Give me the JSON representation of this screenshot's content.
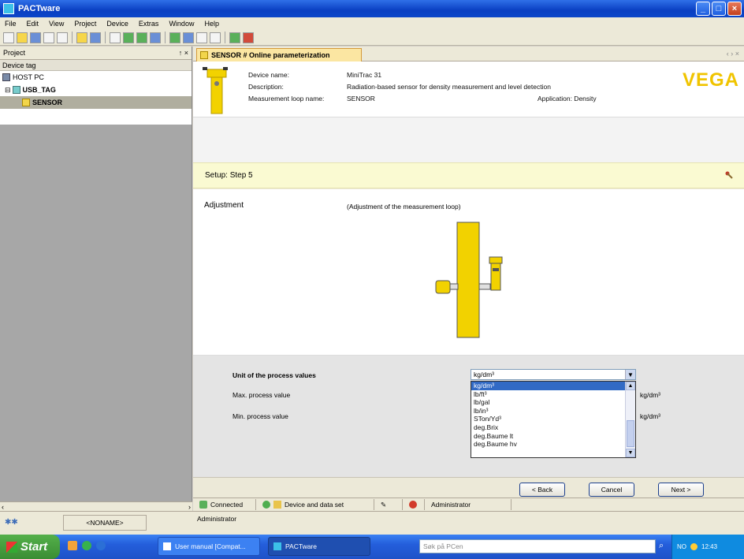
{
  "window": {
    "title": "PACTware"
  },
  "menu": [
    "File",
    "Edit",
    "View",
    "Project",
    "Device",
    "Extras",
    "Window",
    "Help"
  ],
  "project_panel": {
    "title": "Project",
    "pin": "↑ ×",
    "column_header": "Device tag",
    "tree": [
      {
        "label": "HOST PC",
        "bold": false,
        "indent": 0
      },
      {
        "label": "USB_TAG",
        "bold": true,
        "indent": 1
      },
      {
        "label": "SENSOR",
        "bold": true,
        "indent": 2,
        "selected": true
      }
    ]
  },
  "doc_tab": {
    "title": "SENSOR # Online parameterization",
    "arrows": "‹ › ×"
  },
  "device": {
    "name_label": "Device name:",
    "name_value": "MiniTrac 31",
    "description_label": "Description:",
    "description_value": "Radiation-based sensor for density measurement and level detection",
    "loop_label": "Measurement loop name:",
    "loop_value": "SENSOR",
    "application": "Application: Density",
    "brand": "VEGA"
  },
  "setup": {
    "step": "Setup: Step 5"
  },
  "adjustment": {
    "title": "Adjustment",
    "description": "(Adjustment of the measurement loop)"
  },
  "units": {
    "title": "Unit of the process values",
    "max_label": "Max. process value",
    "min_label": "Min. process value",
    "selected": "kg/dm³",
    "max_unit": "kg/dm³",
    "min_unit": "kg/dm³",
    "options": [
      "kg/dm³",
      "lb/ft³",
      "lb/gal",
      "lb/in³",
      "STon/Yd³",
      "deg.Brix",
      "deg.Baume lt",
      "deg.Baume hv"
    ]
  },
  "buttons": {
    "back": "< Back",
    "cancel": "Cancel",
    "next": "Next >"
  },
  "status": {
    "connection": "Connected",
    "dataset": "Device and data set",
    "user": "Administrator"
  },
  "bottom": {
    "noname": "<NONAME>",
    "user": "Administrator"
  },
  "taskbar": {
    "start": "Start",
    "items": [
      "User manual [Compat...",
      "PACTware"
    ],
    "search_placeholder": "Søk på PCen",
    "tray_lang": "NO",
    "clock": "12:43"
  }
}
